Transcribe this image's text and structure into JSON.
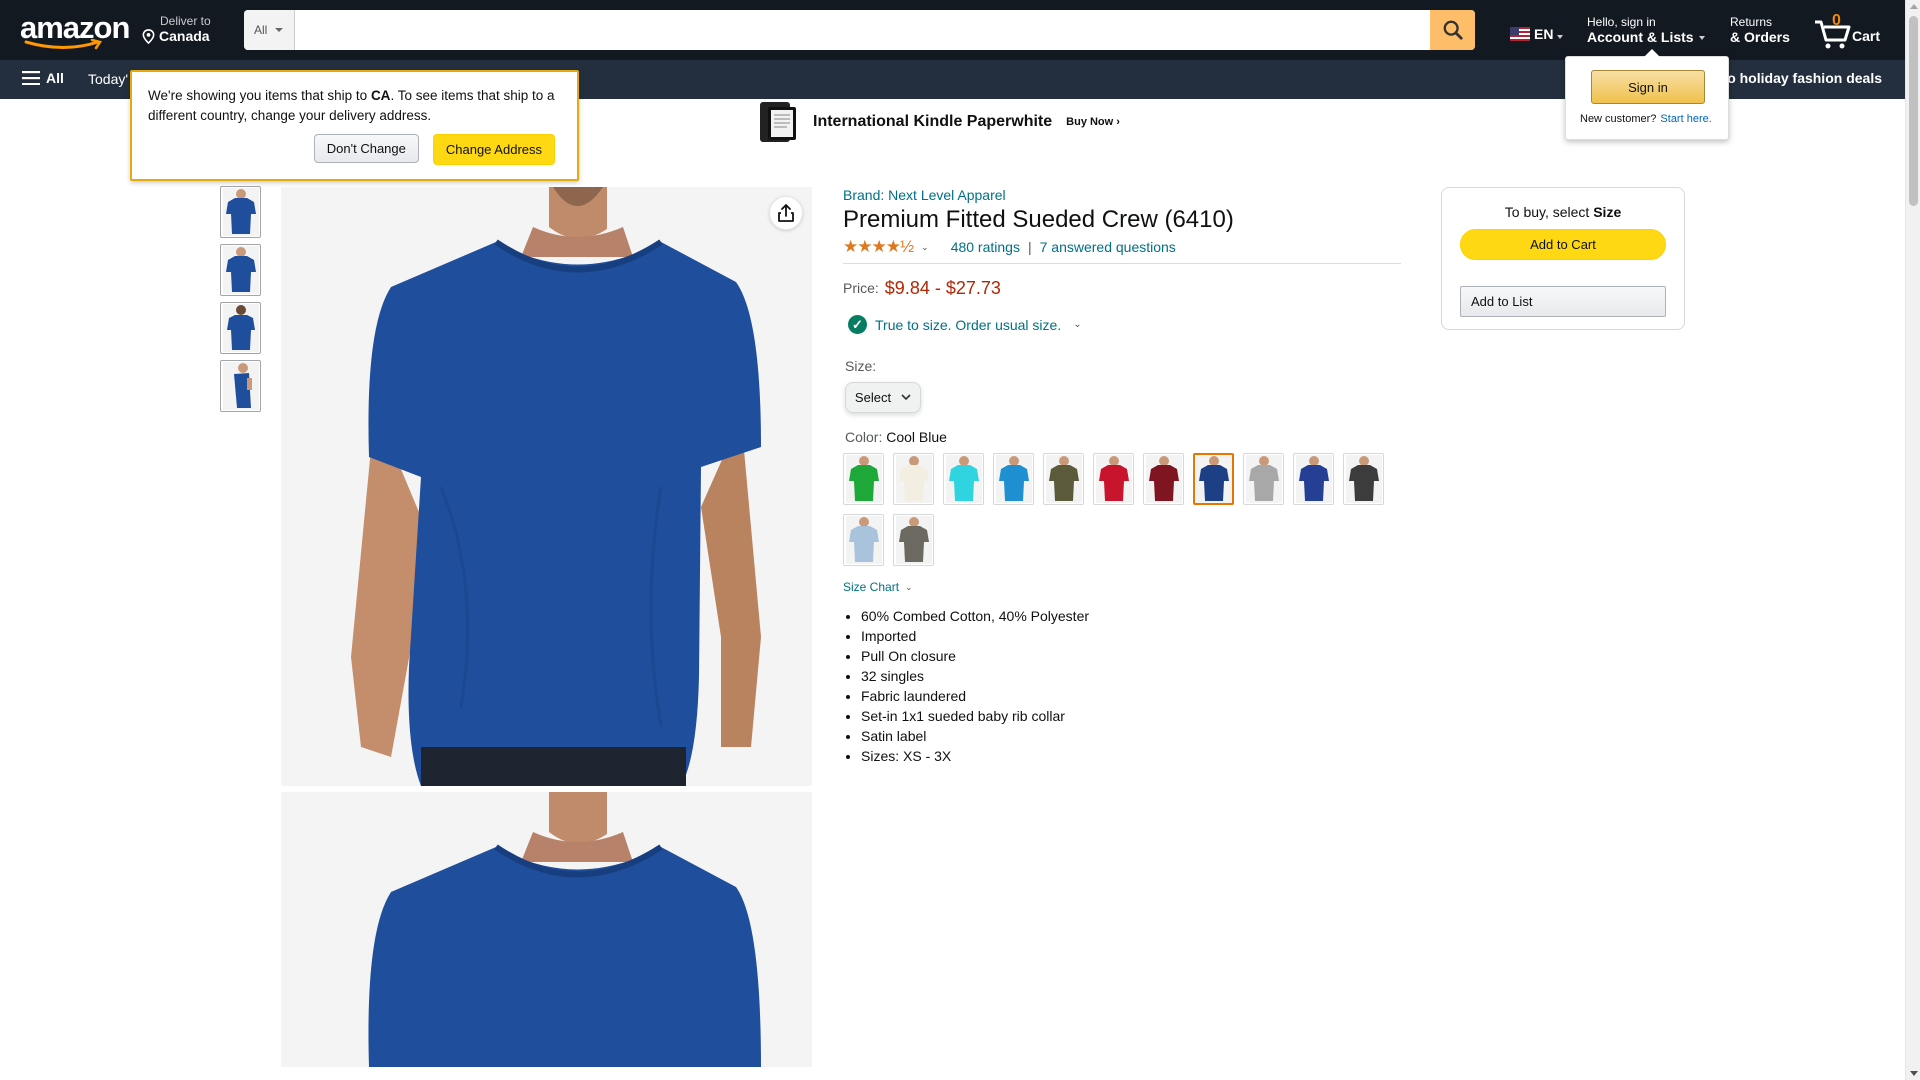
{
  "header": {
    "logo_text": "amazon",
    "deliver_small": "Deliver to",
    "deliver_big": "Canada",
    "search_category": "All",
    "search_placeholder": "",
    "lang": "EN",
    "account_small": "Hello, sign in",
    "account_big": "Account & Lists",
    "returns_small": "Returns",
    "returns_big": "& Orders",
    "cart_count": "0",
    "cart_label": "Cart",
    "colors": {
      "nav_bg": "#131921",
      "subnav_bg": "#232f3e",
      "search_btn": "#febd69",
      "accent": "#f08804"
    }
  },
  "subnav": {
    "all_label": "All",
    "today_label": "Today'",
    "right_label": "o holiday fashion deals"
  },
  "banner": {
    "title": "International Kindle Paperwhite",
    "cta": "Buy Now ›"
  },
  "delivery_popover": {
    "text_before": "We're showing you items that ship to ",
    "country": "CA",
    "text_after": ". To see items that ship to a different country, change your delivery address.",
    "dont_change": "Don't Change",
    "change_address": "Change Address"
  },
  "signin_flyout": {
    "button": "Sign in",
    "new_customer": "New customer?",
    "start_here": "Start here."
  },
  "product": {
    "brand": "Brand: Next Level Apparel",
    "title": "Premium Fitted Sueded Crew (6410)",
    "stars": "★★★★½",
    "rating_value": 4.5,
    "ratings": "480 ratings",
    "separator": "|",
    "answered": "7 answered questions",
    "price_label": "Price:",
    "price": "$9.84 - $27.73",
    "fit_text": "True to size. Order usual size.",
    "size_label": "Size:",
    "size_select": "Select",
    "color_label": "Color:",
    "color_value": "Cool Blue",
    "swatch_colors": [
      "#1fa83a",
      "#f2efe2",
      "#2fd4e0",
      "#1e8fd0",
      "#5b5a3a",
      "#c8142c",
      "#7e1520",
      "#1d3f86",
      "#a8a8a8",
      "#253f94",
      "#3c3c3c",
      "#a9c3dc",
      "#6c6a60"
    ],
    "selected_swatch": 7,
    "size_chart": "Size Chart",
    "bullets": [
      "60% Combed Cotton, 40% Polyester",
      "Imported",
      "Pull On closure",
      "32 singles",
      "Fabric laundered",
      "Set-in 1x1 sueded baby rib collar",
      "Satin label",
      "Sizes: XS - 3X"
    ]
  },
  "buybox": {
    "text": "To buy, select ",
    "text_bold": "Size",
    "add_to_cart": "Add to Cart",
    "add_to_list": "Add to List"
  },
  "shirt_color": "#1f4f9c"
}
